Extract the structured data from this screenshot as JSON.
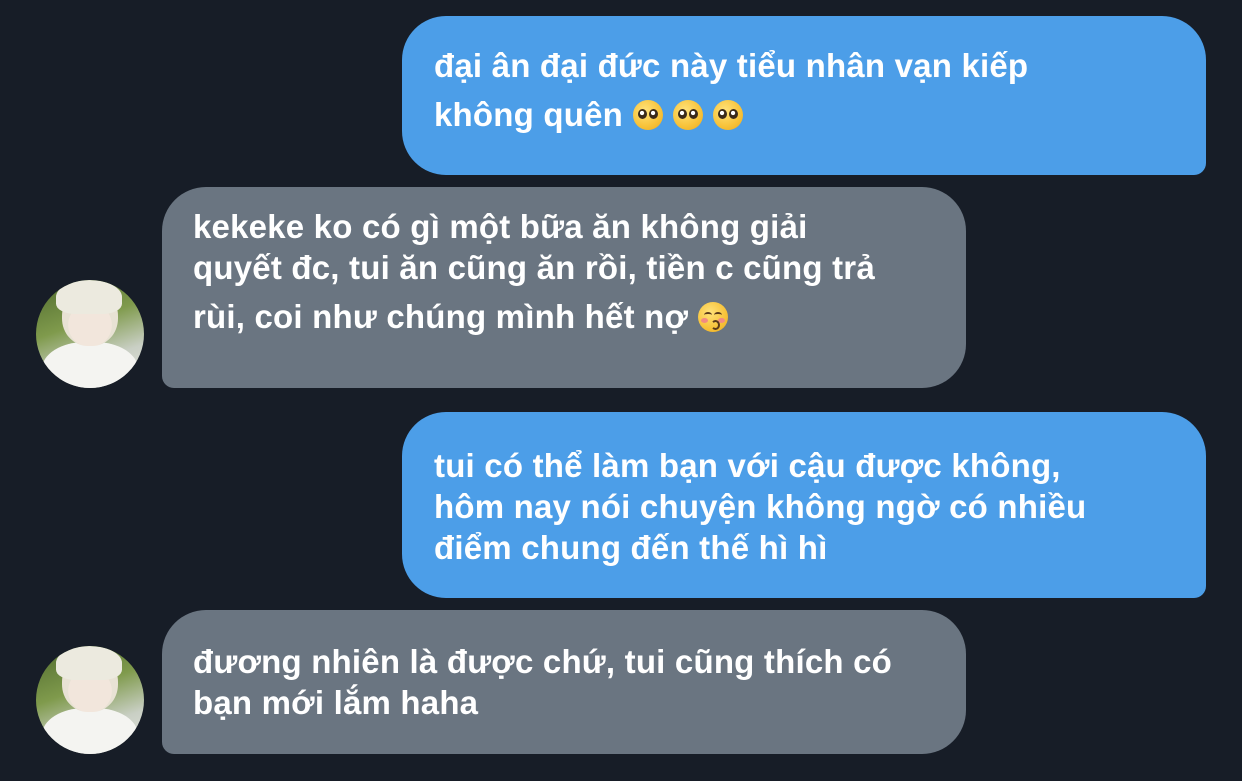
{
  "messages": [
    {
      "side": "sent",
      "lines": [
        "đại ân đại đức này tiểu nhân vạn kiếp",
        "không quên"
      ],
      "emoji": [
        "pleading-face-icon",
        "pleading-face-icon",
        "pleading-face-icon"
      ]
    },
    {
      "side": "received",
      "lines": [
        "kekeke ko có gì một bữa ăn không giải",
        "quyết đc, tui ăn cũng ăn rồi, tiền c cũng trả",
        "rùi, coi như chúng mình hết nợ"
      ],
      "emoji": [
        "kissing-closed-eyes-face-icon"
      ]
    },
    {
      "side": "sent",
      "lines": [
        "tui có thể làm bạn với cậu được không,",
        "hôm nay nói chuyện không ngờ có nhiều",
        "điểm chung đến thế hì hì"
      ]
    },
    {
      "side": "received",
      "lines": [
        "đương nhiên là được chứ, tui cũng thích có",
        "bạn mới lắm haha"
      ]
    }
  ],
  "colors": {
    "background": "#171d27",
    "sent_bubble": "#4c9ee8",
    "received_bubble": "#6a7581",
    "text": "#ffffff"
  }
}
